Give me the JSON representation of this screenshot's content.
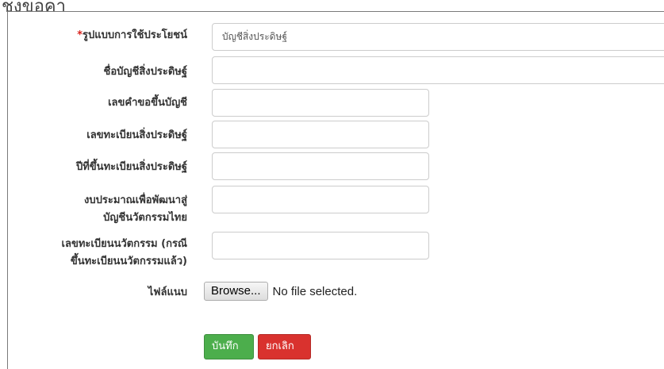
{
  "page": {
    "heading": "ชงขอคา"
  },
  "form": {
    "required_mark": "*",
    "usage_type": {
      "label": "รูปแบบการใช้ประโยชน์",
      "value": "บัญชีสิ่งประดิษฐ์"
    },
    "account_name": {
      "label": "ชื่อบัญชีสิ่งประดิษฐ์",
      "value": ""
    },
    "request_number": {
      "label": "เลขคำขอขึ้นบัญชี",
      "value": ""
    },
    "invention_reg_number": {
      "label": "เลขทะเบียนสิ่งประดิษฐ์",
      "value": ""
    },
    "invention_reg_year": {
      "label": "ปีที่ขึ้นทะเบียนสิ่งประดิษฐ์",
      "value": ""
    },
    "budget": {
      "label_line1": "งบประมาณเพื่อพัฒนาสู่",
      "label_line2": "บัญชีนวัตกรรมไทย",
      "value": ""
    },
    "innovation_reg_number": {
      "label_line1": "เลขทะเบียนนวัตกรรม (กรณี",
      "label_line2": "ขึ้นทะเบียนนวัตกรรมแล้ว)",
      "value": ""
    },
    "attachment": {
      "label": "ไฟล์แนบ",
      "browse_label": "Browse...",
      "status": "No file selected."
    }
  },
  "actions": {
    "save_label": "บันทึก",
    "cancel_label": "ยกเลิก"
  },
  "colors": {
    "save": "#4cae4c",
    "cancel": "#d9322e",
    "required": "#d9211b"
  }
}
